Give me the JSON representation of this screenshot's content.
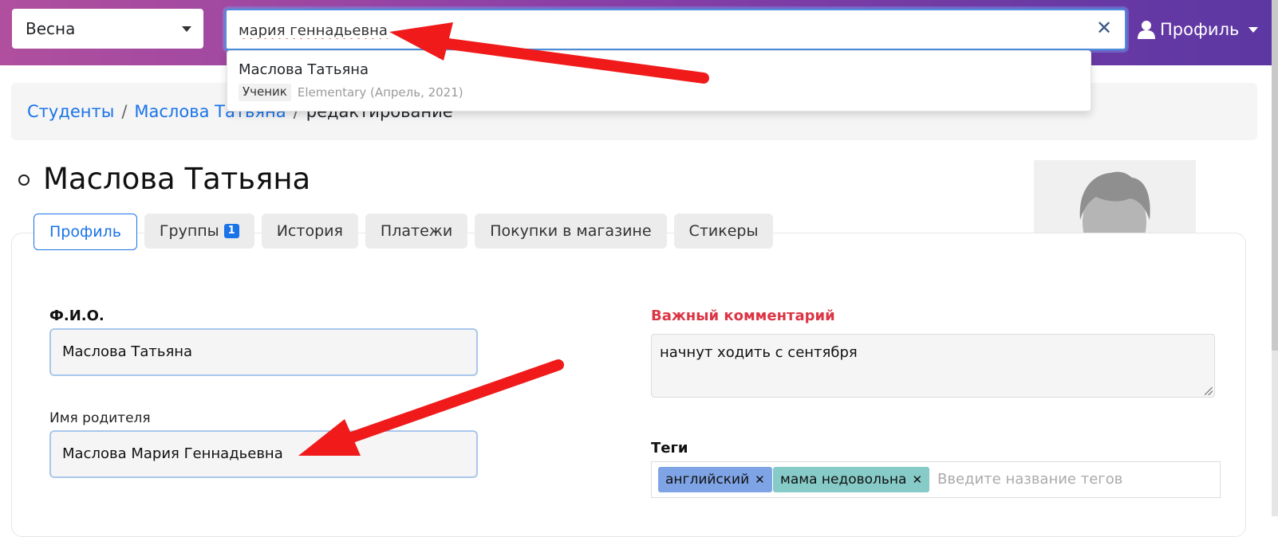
{
  "topbar": {
    "season": "Весна",
    "search_value": "мария геннадьевна",
    "profile_label": "Профиль"
  },
  "dropdown": {
    "result_name": "Маслова Татьяна",
    "result_role": "Ученик",
    "result_group": "Elementary (Апрель, 2021)"
  },
  "breadcrumb": {
    "items": [
      "Студенты",
      "Маслова Татьяна"
    ],
    "current": "редактирование",
    "separator": "/"
  },
  "page": {
    "title": "Маслова Татьяна"
  },
  "tabs": [
    {
      "label": "Профиль"
    },
    {
      "label": "Группы",
      "badge": "1"
    },
    {
      "label": "История"
    },
    {
      "label": "Платежи"
    },
    {
      "label": "Покупки в магазине"
    },
    {
      "label": "Стикеры"
    }
  ],
  "form": {
    "fio_label": "Ф.И.О.",
    "fio_value": "Маслова Татьяна",
    "parent_label": "Имя родителя",
    "parent_value": "Маслова Мария Геннадьевна",
    "comment_label": "Важный комментарий",
    "comment_value": "начнут ходить с сентября",
    "tags_label": "Теги",
    "tags": [
      "английский",
      "мама недовольна"
    ],
    "tags_placeholder": "Введите название тегов"
  },
  "colors": {
    "accent": "#1a73e8",
    "important": "#dc3545",
    "annotation_arrow": "#f01a1a"
  }
}
